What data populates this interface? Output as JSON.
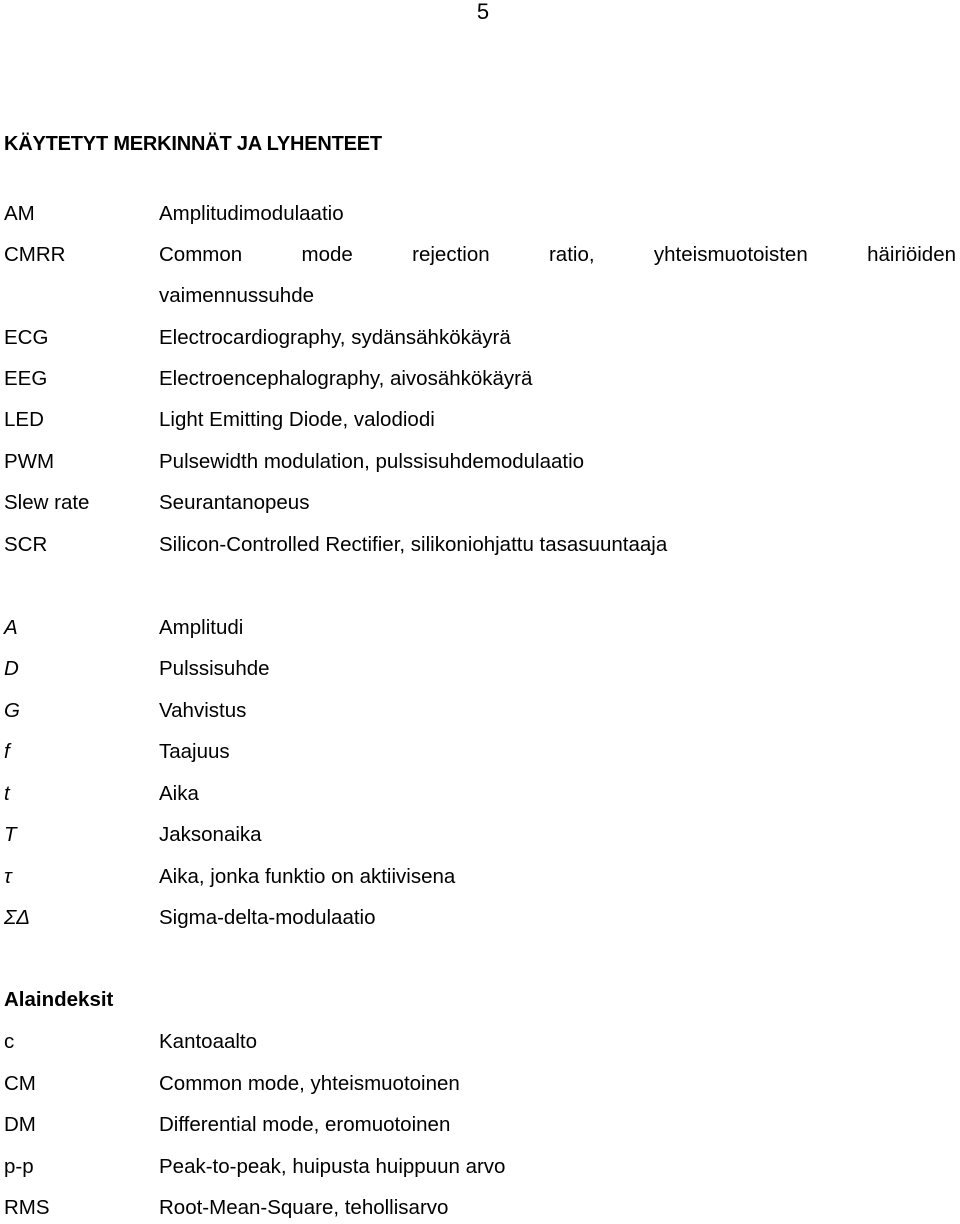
{
  "page": {
    "number": "5",
    "heading": "KÄYTETYT MERKINNÄT JA LYHENTEET"
  },
  "abbreviations": [
    {
      "term": "AM",
      "definition": "Amplitudimodulaatio"
    },
    {
      "term": "CMRR",
      "definition_words": [
        "Common",
        "mode",
        "rejection",
        "ratio,",
        "yhteismuotoisten",
        "häiriöiden"
      ],
      "definition_cont": "vaimennussuhde"
    },
    {
      "term": "ECG",
      "definition": "Electrocardiography, sydänsähkökäyrä"
    },
    {
      "term": "EEG",
      "definition": "Electroencephalography, aivosähkökäyrä"
    },
    {
      "term": "LED",
      "definition": "Light Emitting Diode, valodiodi"
    },
    {
      "term": "PWM",
      "definition": "Pulsewidth modulation, pulssisuhdemodulaatio"
    },
    {
      "term": "Slew rate",
      "definition": "Seurantanopeus"
    },
    {
      "term": "SCR",
      "definition": "Silicon-Controlled Rectifier, silikoniohjattu tasasuuntaaja"
    }
  ],
  "symbols": [
    {
      "term": "A",
      "definition": "Amplitudi"
    },
    {
      "term": "D",
      "definition": "Pulssisuhde"
    },
    {
      "term": "G",
      "definition": "Vahvistus"
    },
    {
      "term": "f",
      "definition": "Taajuus"
    },
    {
      "term": "t",
      "definition": "Aika"
    },
    {
      "term": "T",
      "definition": "Jaksonaika"
    },
    {
      "term": "τ",
      "definition": "Aika, jonka funktio on aktiivisena"
    },
    {
      "term": "ΣΔ",
      "definition": "Sigma-delta-modulaatio"
    }
  ],
  "subscripts": {
    "heading": "Alaindeksit",
    "items": [
      {
        "term": "c",
        "definition": "Kantoaalto"
      },
      {
        "term": "CM",
        "definition": "Common mode, yhteismuotoinen"
      },
      {
        "term": "DM",
        "definition": "Differential mode, eromuotoinen"
      },
      {
        "term": "p-p",
        "definition": "Peak-to-peak, huipusta huippuun arvo"
      },
      {
        "term": "RMS",
        "definition": "Root-Mean-Square, tehollisarvo"
      }
    ]
  }
}
